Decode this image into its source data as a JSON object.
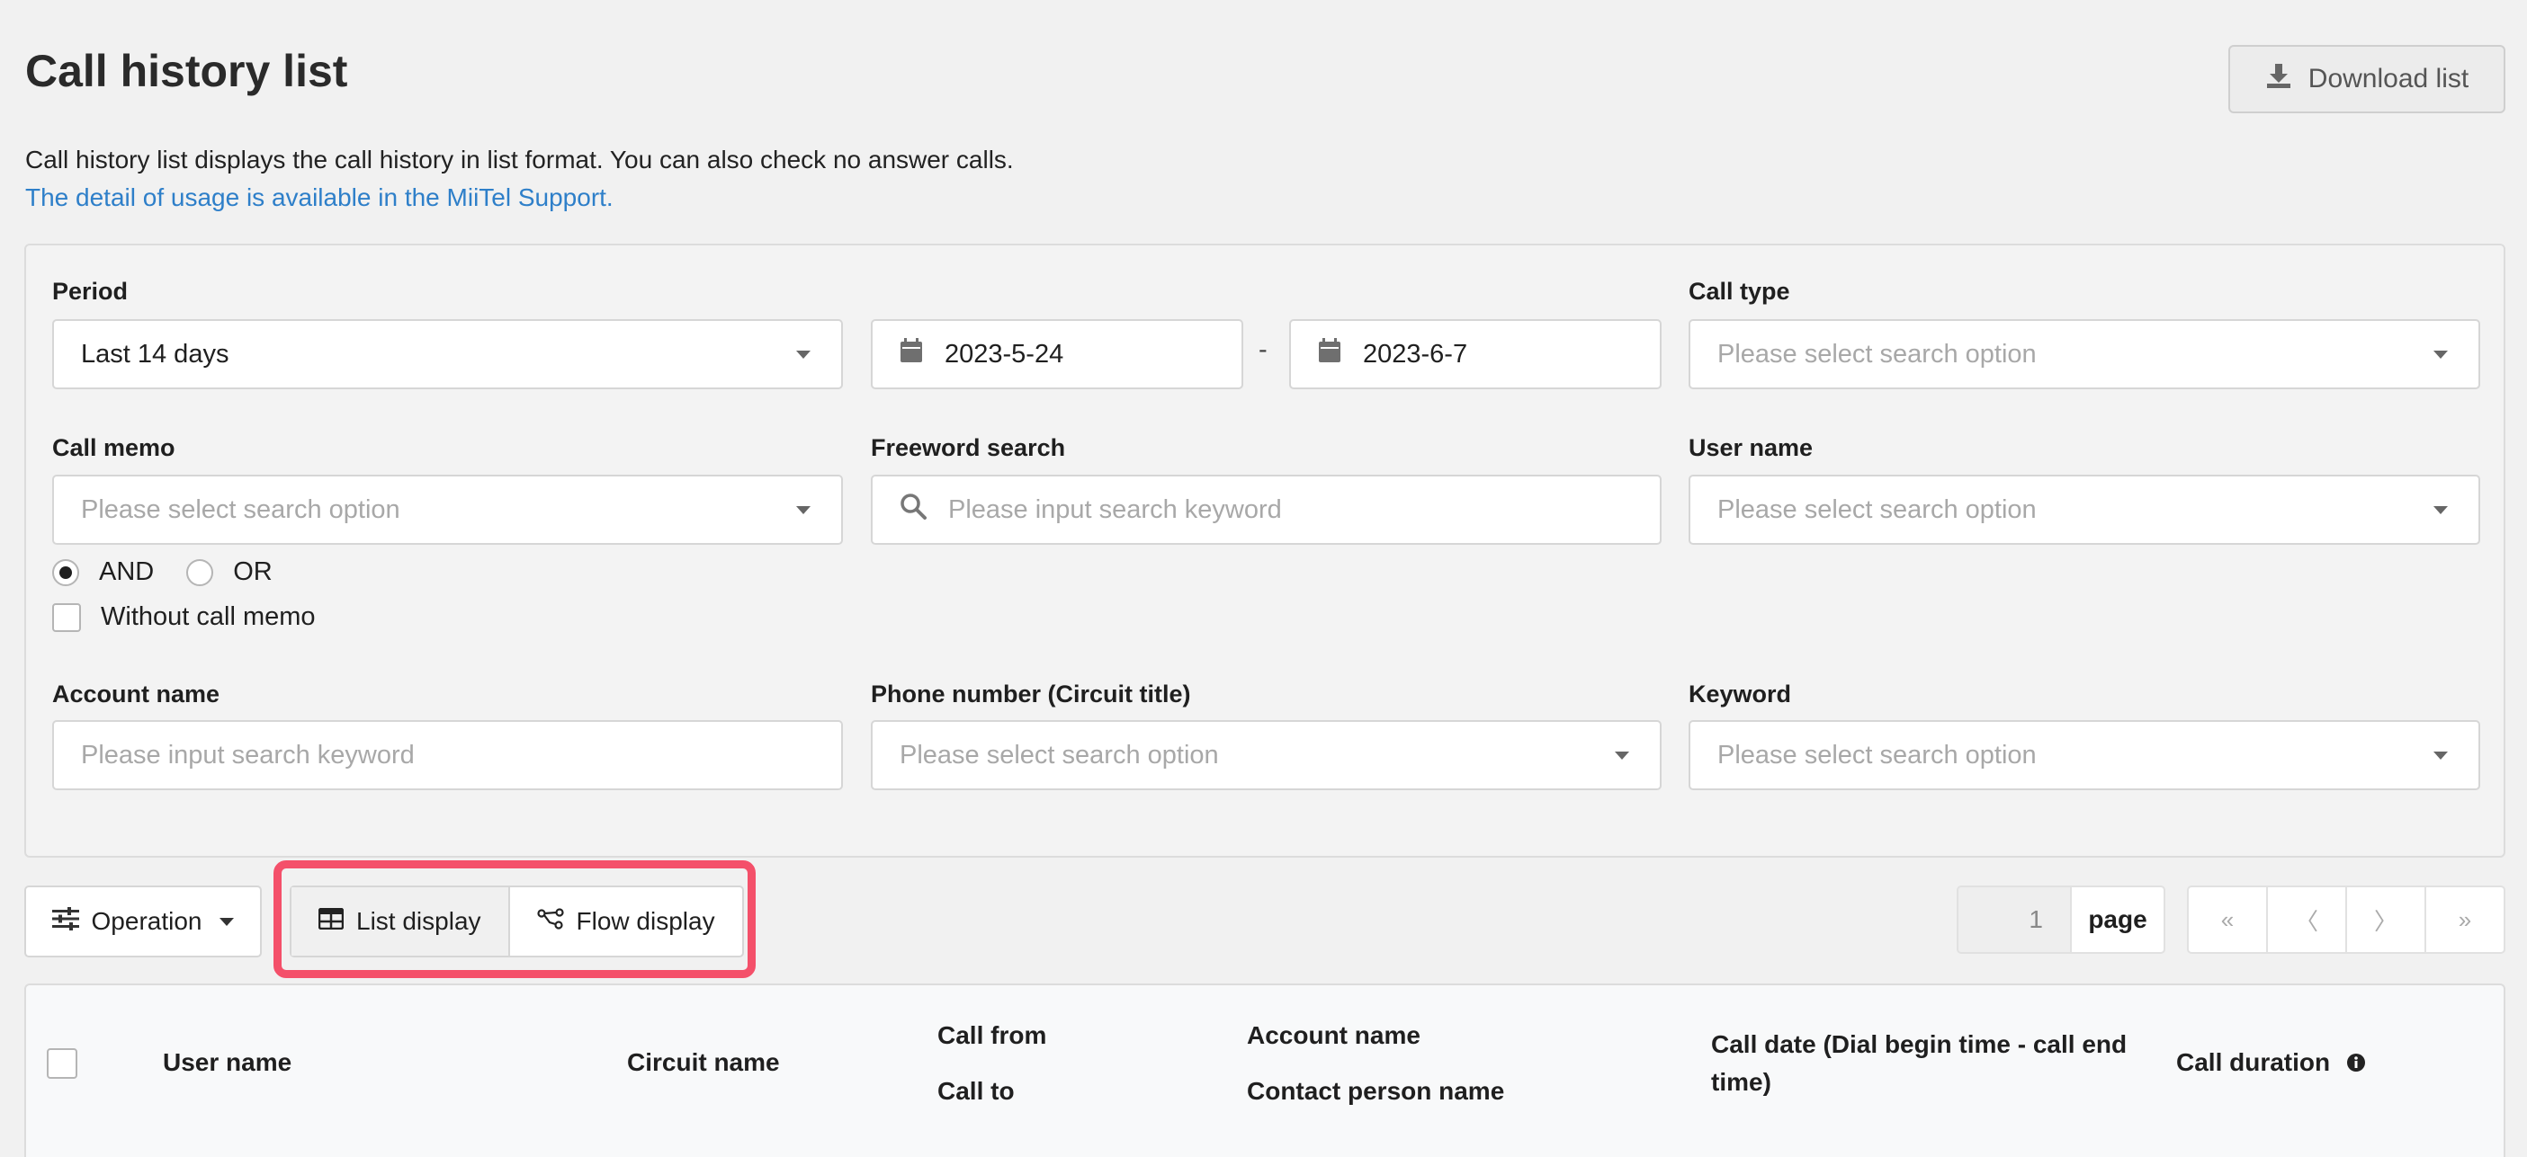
{
  "header": {
    "title": "Call history list",
    "download_label": "Download list",
    "description": "Call history list displays the call history in list format. You can also check no answer calls.",
    "support_link": "The detail of usage is available in the MiiTel Support."
  },
  "filters": {
    "period": {
      "label": "Period",
      "value": "Last 14 days"
    },
    "date_from": "2023-5-24",
    "date_separator": "-",
    "date_to": "2023-6-7",
    "call_type": {
      "label": "Call type",
      "placeholder": "Please select search option"
    },
    "call_memo": {
      "label": "Call memo",
      "placeholder": "Please select search option"
    },
    "freeword": {
      "label": "Freeword search",
      "placeholder": "Please input search keyword"
    },
    "user_name": {
      "label": "User name",
      "placeholder": "Please select search option"
    },
    "logic": {
      "and_label": "AND",
      "or_label": "OR",
      "selected": "AND"
    },
    "without_memo_label": "Without call memo",
    "account_name": {
      "label": "Account name",
      "placeholder": "Please input search keyword"
    },
    "phone_number": {
      "label": "Phone number (Circuit title)",
      "placeholder": "Please select search option"
    },
    "keyword": {
      "label": "Keyword",
      "placeholder": "Please select search option"
    }
  },
  "toolbar": {
    "operation_label": "Operation",
    "list_display_label": "List display",
    "flow_display_label": "Flow display",
    "page_value": "1",
    "page_label": "page",
    "pager": {
      "first": "«",
      "prev": "〈",
      "next": "〉",
      "last": "»"
    }
  },
  "table": {
    "columns": {
      "user_name": "User name",
      "circuit_name": "Circuit name",
      "call_from": "Call from",
      "call_to": "Call to",
      "account_name": "Account name",
      "contact_person": "Contact person name",
      "call_date_line1": "Call date (Dial begin time - call end",
      "call_date_line2": "time)",
      "call_duration": "Call duration"
    }
  },
  "colors": {
    "highlight": "#f4506a",
    "link": "#2e7fc9"
  },
  "icons": [
    "download-icon",
    "calendar-icon",
    "search-icon",
    "sliders-icon",
    "table-icon",
    "flow-icon",
    "info-icon"
  ]
}
